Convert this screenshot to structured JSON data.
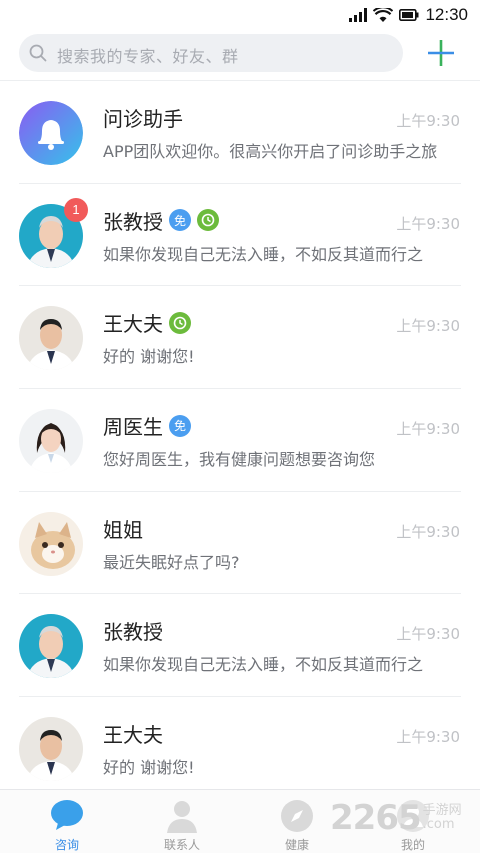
{
  "status": {
    "time": "12:30",
    "icons": [
      "signal-icon",
      "wifi-icon",
      "battery-icon"
    ]
  },
  "search": {
    "placeholder": "搜索我的专家、好友、群",
    "icon": "search-icon"
  },
  "add_icon": "plus-icon",
  "colors": {
    "accent": "#3a8ee6",
    "badge": "#f15a5a",
    "free_tag": "#4b9ef0",
    "clock_tag": "#6cbb3c",
    "add_plus": "#39b25c"
  },
  "chats": [
    {
      "name": "问诊助手",
      "time": "上午9:30",
      "message": "APP团队欢迎你。很高兴你开启了问诊助手之旅",
      "avatar": "bell-icon",
      "badge": "",
      "tags": []
    },
    {
      "name": "张教授",
      "time": "上午9:30",
      "message": "如果你发现自己无法入睡，不如反其道而行之",
      "avatar": "doctor-avatar",
      "badge": "1",
      "tags": [
        "免",
        "clock"
      ]
    },
    {
      "name": "王大夫",
      "time": "上午9:30",
      "message": "好的 谢谢您!",
      "avatar": "doctor-avatar",
      "badge": "",
      "tags": [
        "clock"
      ]
    },
    {
      "name": "周医生",
      "time": "上午9:30",
      "message": "您好周医生，我有健康问题想要咨询您",
      "avatar": "doctor-avatar",
      "badge": "",
      "tags": [
        "免"
      ]
    },
    {
      "name": "姐姐",
      "time": "上午9:30",
      "message": "最近失眠好点了吗?",
      "avatar": "cat-avatar",
      "badge": "",
      "tags": []
    },
    {
      "name": "张教授",
      "time": "上午9:30",
      "message": "如果你发现自己无法入睡，不如反其道而行之",
      "avatar": "doctor-avatar",
      "badge": "",
      "tags": []
    },
    {
      "name": "王大夫",
      "time": "上午9:30",
      "message": "好的 谢谢您!",
      "avatar": "doctor-avatar",
      "badge": "",
      "tags": []
    }
  ],
  "tabs": [
    {
      "label": "咨询",
      "icon": "chat-bubble-icon",
      "active": true
    },
    {
      "label": "联系人",
      "icon": "person-icon",
      "active": false
    },
    {
      "label": "健康",
      "icon": "compass-icon",
      "active": false
    },
    {
      "label": "我的",
      "icon": "profile-icon",
      "active": false
    }
  ],
  "watermark": {
    "number": "2265",
    "text": "手游网",
    "domain": ".com"
  }
}
